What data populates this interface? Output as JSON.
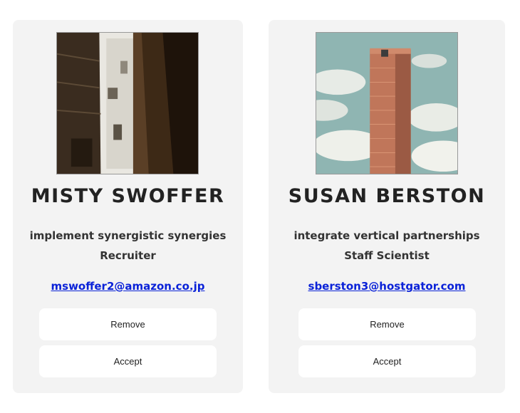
{
  "cards": [
    {
      "name": "MISTY SWOFFER",
      "tagline": "implement synergistic synergies",
      "role": "Recruiter",
      "email": "mswoffer2@amazon.co.jp",
      "remove_label": "Remove",
      "accept_label": "Accept",
      "photo_icon": "alley-buildings-photo"
    },
    {
      "name": "SUSAN BERSTON",
      "tagline": "integrate vertical partnerships",
      "role": "Staff Scientist",
      "email": "sberston3@hostgator.com",
      "remove_label": "Remove",
      "accept_label": "Accept",
      "photo_icon": "skyscraper-sky-photo"
    }
  ],
  "colors": {
    "card_background": "#f3f3f3",
    "name_text": "#222222",
    "link": "#0a22d8",
    "button_background": "#ffffff"
  }
}
